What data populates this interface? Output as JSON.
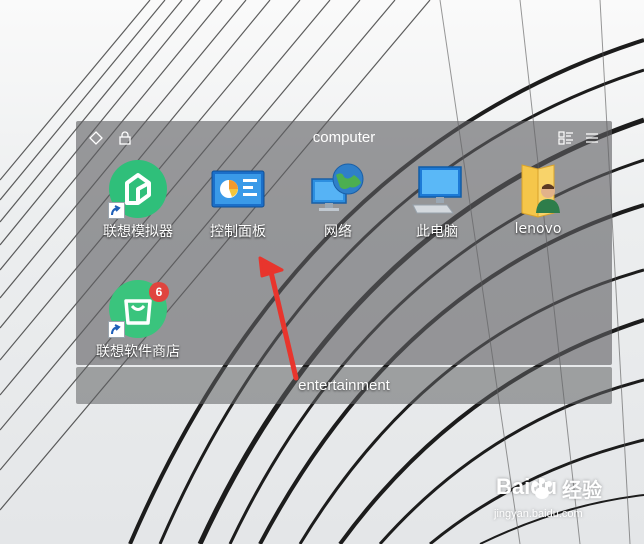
{
  "main_group": {
    "title": "computer",
    "icons": [
      {
        "label": "联想模拟器",
        "icon": "lenovo-emulator-icon",
        "shortcut": true
      },
      {
        "label": "控制面板",
        "icon": "control-panel-icon",
        "shortcut": false
      },
      {
        "label": "网络",
        "icon": "network-icon",
        "shortcut": false
      },
      {
        "label": "此电脑",
        "icon": "this-pc-icon",
        "shortcut": false
      },
      {
        "label": "lenovo",
        "icon": "user-folder-icon",
        "shortcut": false
      },
      {
        "label": "联想软件商店",
        "icon": "lenovo-app-store-icon",
        "shortcut": true,
        "badge": "6"
      }
    ]
  },
  "second_group": {
    "title": "entertainment"
  },
  "watermark": {
    "brand": "Baidu",
    "cn": "经验",
    "url": "jingyan.baidu.com"
  },
  "colors": {
    "panel": "#5f6062",
    "emulator_green": "#2fbf7a",
    "store_green": "#3ac47d",
    "badge_red": "#e0443e",
    "arrow_red": "#e8352d",
    "folder_yellow": "#f5c64a"
  }
}
